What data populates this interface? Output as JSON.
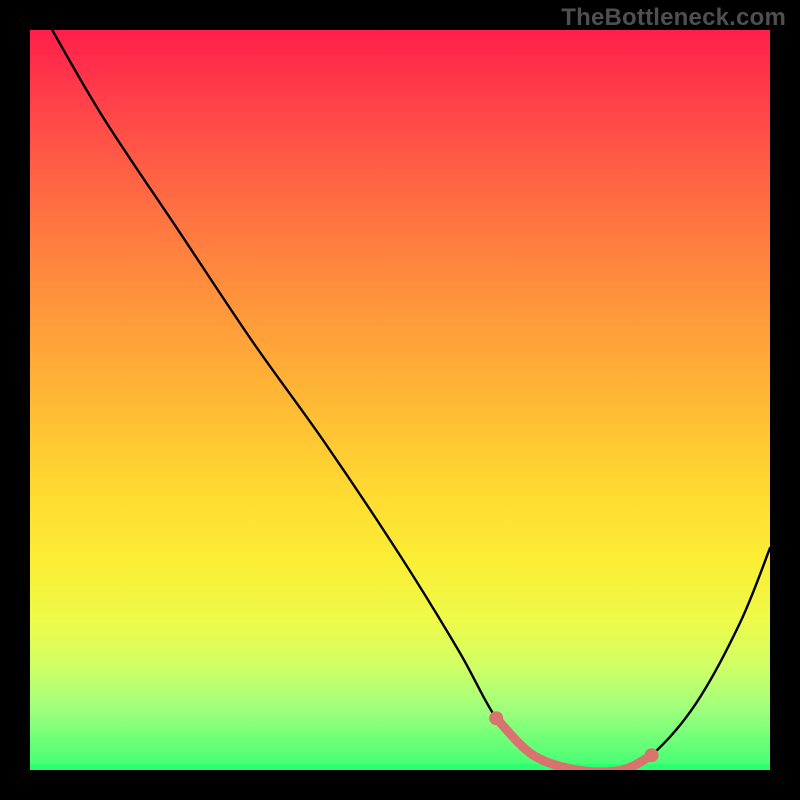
{
  "attribution": "TheBottleneck.com",
  "chart_data": {
    "type": "line",
    "title": "",
    "xlabel": "",
    "ylabel": "",
    "xlim": [
      0,
      100
    ],
    "ylim": [
      0,
      100
    ],
    "background": {
      "type": "vertical-gradient",
      "stops": [
        {
          "pos": 0,
          "color": "#ff1f4b"
        },
        {
          "pos": 16,
          "color": "#ff5646"
        },
        {
          "pos": 32,
          "color": "#ff873e"
        },
        {
          "pos": 48,
          "color": "#ffb336"
        },
        {
          "pos": 64,
          "color": "#ffde31"
        },
        {
          "pos": 80,
          "color": "#edfb4a"
        },
        {
          "pos": 92,
          "color": "#9dff7c"
        },
        {
          "pos": 100,
          "color": "#3eff74"
        }
      ]
    },
    "series": [
      {
        "name": "bottleneck-curve",
        "color": "#000000",
        "x": [
          3,
          10,
          20,
          30,
          40,
          50,
          58,
          63,
          68,
          74,
          80,
          84,
          90,
          96,
          100
        ],
        "values": [
          100,
          88,
          73,
          58,
          44,
          29,
          16,
          7,
          2,
          0,
          0,
          2,
          9,
          20,
          30
        ]
      },
      {
        "name": "highlight-segment",
        "color": "#d9736e",
        "x": [
          63,
          68,
          74,
          80,
          84
        ],
        "values": [
          7,
          2,
          0,
          0,
          2
        ]
      }
    ],
    "markers": [
      {
        "x": 63,
        "y": 7,
        "color": "#d9736e"
      },
      {
        "x": 84,
        "y": 2,
        "color": "#d9736e"
      }
    ]
  }
}
